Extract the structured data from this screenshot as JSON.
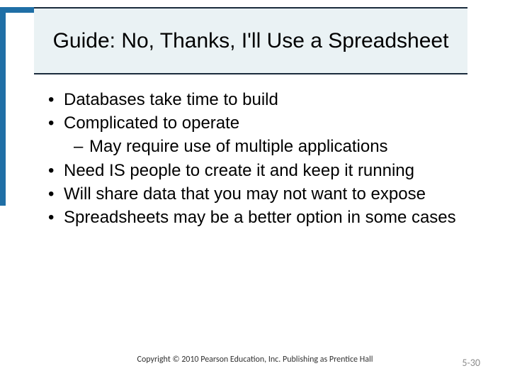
{
  "title": "Guide: No, Thanks, I'll Use a Spreadsheet",
  "bullets": {
    "b0": "Databases take time to build",
    "b1": "Complicated to operate",
    "b1_sub0": "May require use of multiple applications",
    "b2": "Need IS people to create it and keep it running",
    "b3": "Will share data that you may not want to expose",
    "b4": "Spreadsheets may be a better option in some cases"
  },
  "footer": {
    "copyright": "Copyright © 2010 Pearson Education, Inc. Publishing as Prentice Hall",
    "page": "5-30"
  }
}
